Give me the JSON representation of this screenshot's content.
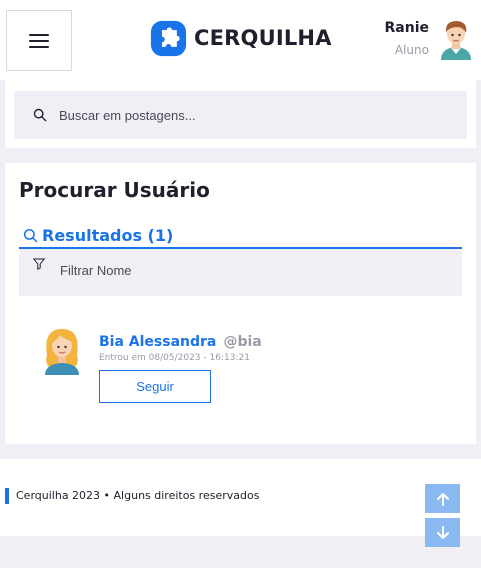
{
  "header": {
    "brand": "CERQUILHA",
    "user_name": "Ranie",
    "user_role": "Aluno"
  },
  "search": {
    "placeholder": "Buscar em postagens..."
  },
  "users_section": {
    "title": "Procurar Usuário",
    "results_label": "Resultados (1)",
    "filter_placeholder": "Filtrar Nome"
  },
  "results": [
    {
      "name": "Bia Alessandra",
      "handle": "@bia",
      "joined": "Entrou em 08/05/2023 - 16:13:21",
      "follow_label": "Seguir"
    }
  ],
  "footer": {
    "text": "Cerquilha 2023 • Alguns direitos reservados"
  },
  "colors": {
    "accent": "#1a73e8",
    "background": "#efeff5",
    "scroll_button": "#8ab8f0"
  },
  "icons": {
    "menu": "hamburger-icon",
    "brand": "puzzle-logo-icon",
    "search": "search-icon",
    "filter": "filter-icon",
    "scroll_up": "arrow-up-icon",
    "scroll_down": "arrow-down-icon"
  }
}
